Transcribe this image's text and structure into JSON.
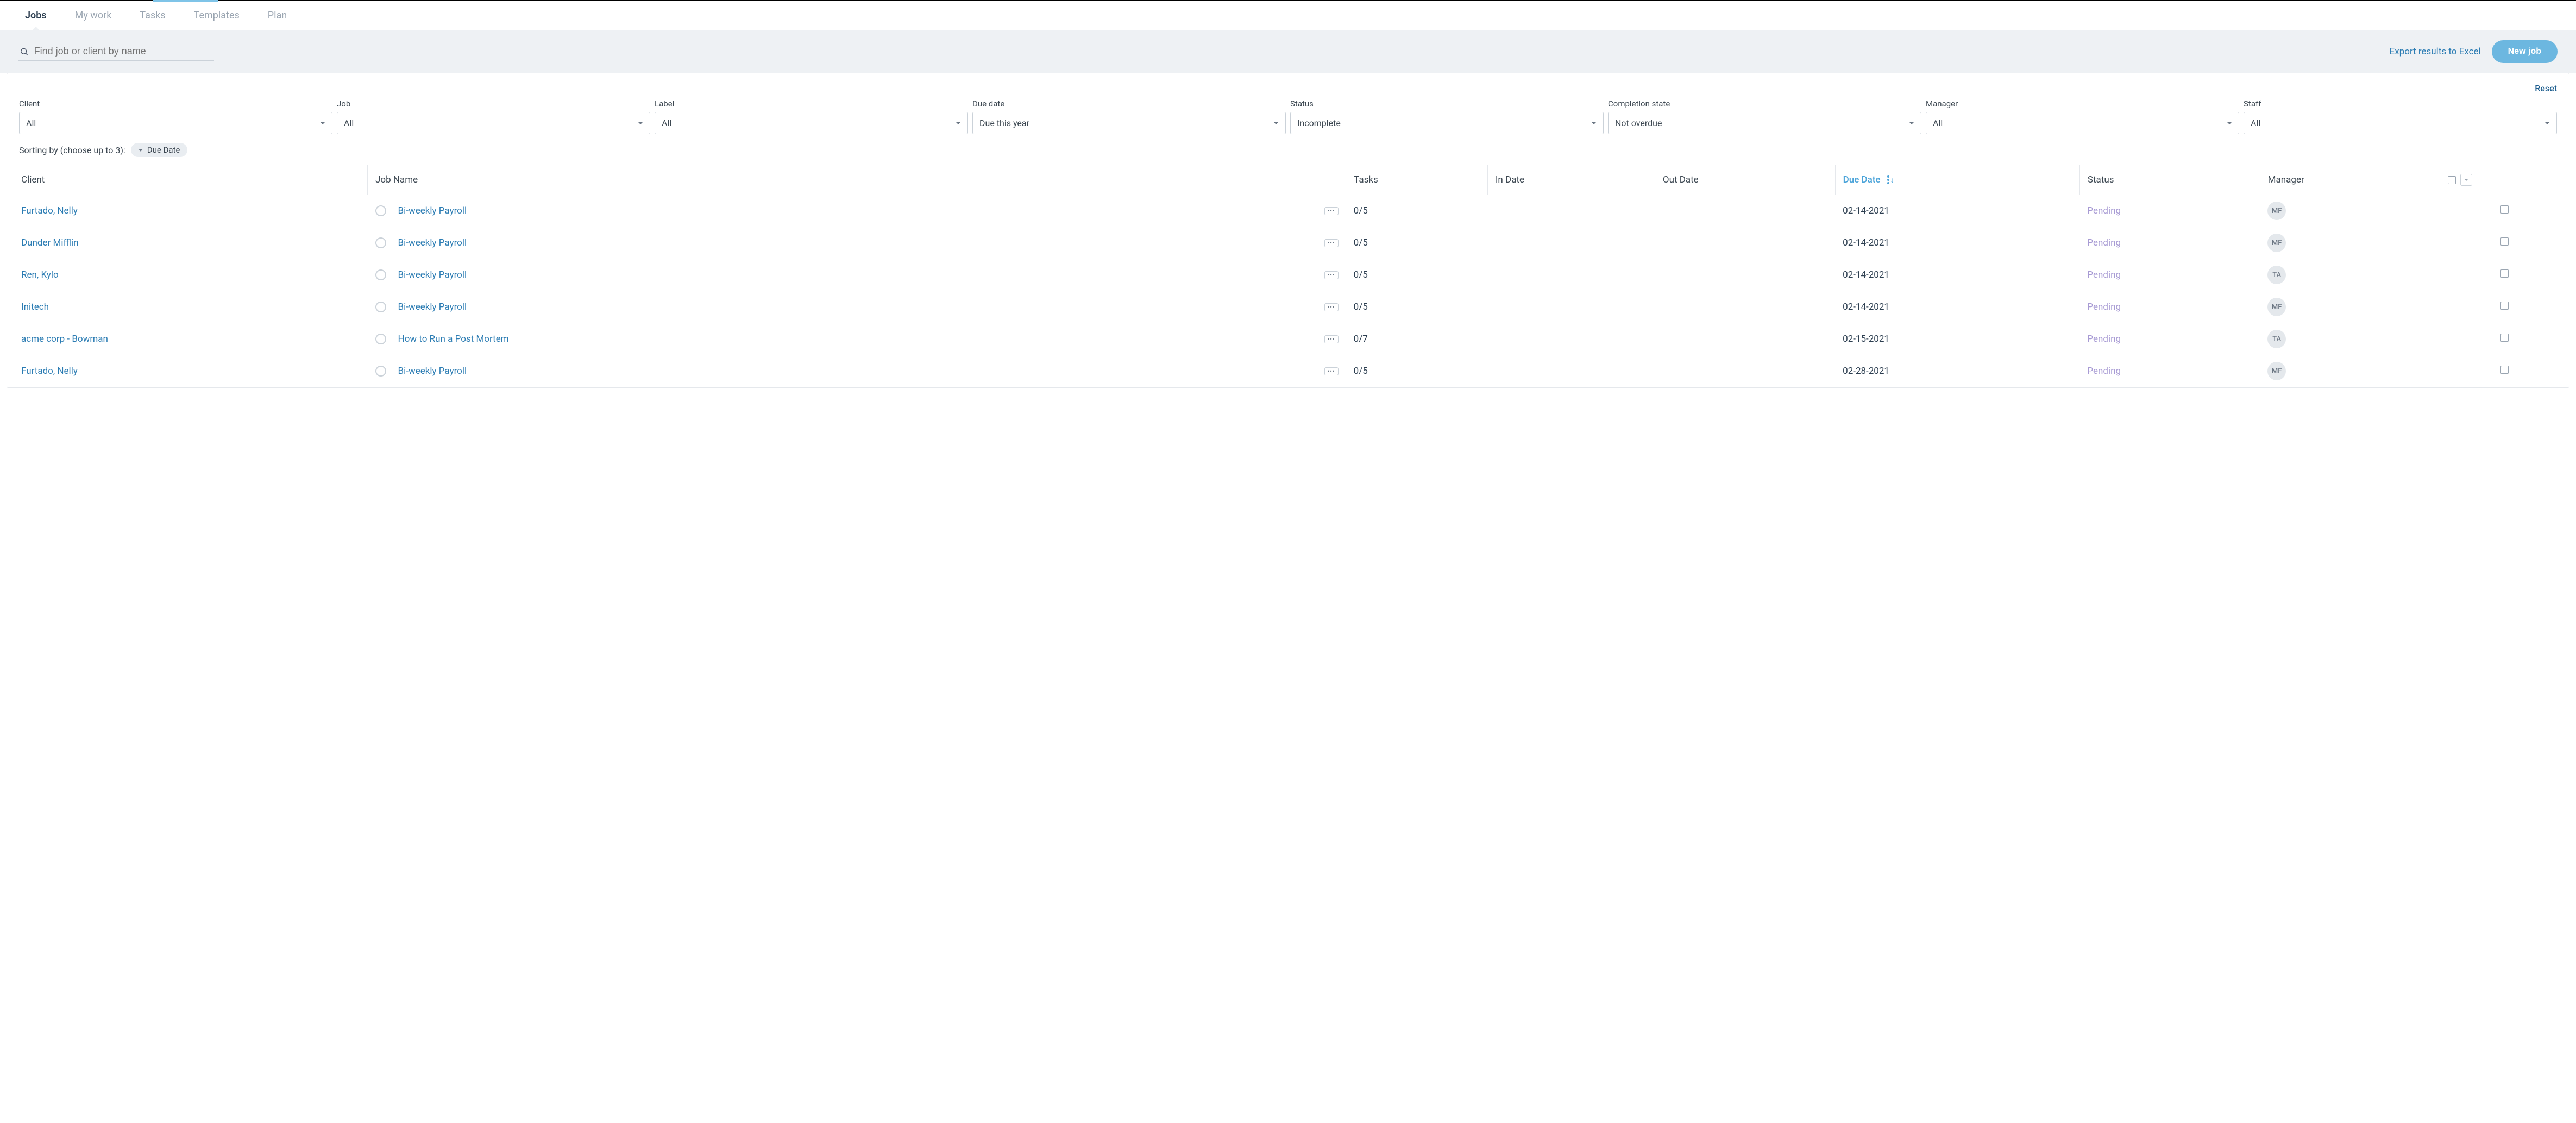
{
  "nav": {
    "tabs": [
      "Jobs",
      "My work",
      "Tasks",
      "Templates",
      "Plan"
    ],
    "active_index": 0
  },
  "toolbar": {
    "search_placeholder": "Find job or client by name",
    "export_label": "Export results to Excel",
    "new_job_label": "New job"
  },
  "filters": {
    "reset_label": "Reset",
    "items": [
      {
        "label": "Client",
        "value": "All"
      },
      {
        "label": "Job",
        "value": "All"
      },
      {
        "label": "Label",
        "value": "All"
      },
      {
        "label": "Due date",
        "value": "Due this year"
      },
      {
        "label": "Status",
        "value": "Incomplete"
      },
      {
        "label": "Completion state",
        "value": "Not overdue"
      },
      {
        "label": "Manager",
        "value": "All"
      },
      {
        "label": "Staff",
        "value": "All"
      }
    ]
  },
  "sorting": {
    "prefix": "Sorting by (choose up to 3):",
    "chip": "Due Date"
  },
  "table": {
    "headers": {
      "client": "Client",
      "jobname": "Job Name",
      "tasks": "Tasks",
      "indate": "In Date",
      "outdate": "Out Date",
      "duedate": "Due Date",
      "status": "Status",
      "manager": "Manager"
    },
    "rows": [
      {
        "client": "Furtado, Nelly",
        "jobname": "Bi-weekly Payroll",
        "tasks": "0/5",
        "indate": "",
        "outdate": "",
        "duedate": "02-14-2021",
        "status": "Pending",
        "manager": "MF"
      },
      {
        "client": "Dunder Mifflin",
        "jobname": "Bi-weekly Payroll",
        "tasks": "0/5",
        "indate": "",
        "outdate": "",
        "duedate": "02-14-2021",
        "status": "Pending",
        "manager": "MF"
      },
      {
        "client": "Ren, Kylo",
        "jobname": "Bi-weekly Payroll",
        "tasks": "0/5",
        "indate": "",
        "outdate": "",
        "duedate": "02-14-2021",
        "status": "Pending",
        "manager": "TA"
      },
      {
        "client": "Initech",
        "jobname": "Bi-weekly Payroll",
        "tasks": "0/5",
        "indate": "",
        "outdate": "",
        "duedate": "02-14-2021",
        "status": "Pending",
        "manager": "MF"
      },
      {
        "client": "acme corp - Bowman",
        "jobname": "How to Run a Post Mortem",
        "tasks": "0/7",
        "indate": "",
        "outdate": "",
        "duedate": "02-15-2021",
        "status": "Pending",
        "manager": "TA"
      },
      {
        "client": "Furtado, Nelly",
        "jobname": "Bi-weekly Payroll",
        "tasks": "0/5",
        "indate": "",
        "outdate": "",
        "duedate": "02-28-2021",
        "status": "Pending",
        "manager": "MF"
      }
    ]
  }
}
